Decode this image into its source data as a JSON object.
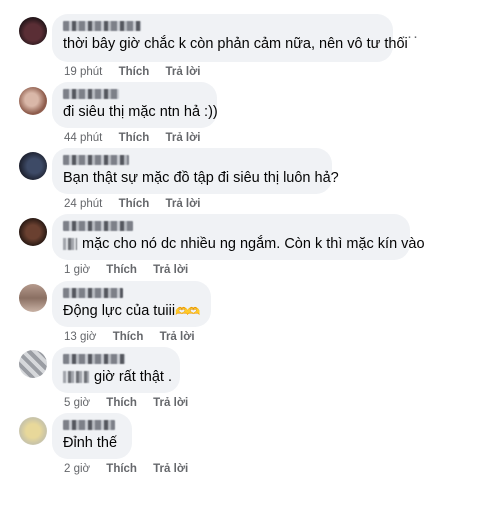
{
  "more_icon": "ellipsis-icon",
  "comments": [
    {
      "text": "thời bây giờ chắc k còn phản cảm nữa, nên vô tư thôi",
      "time": "19 phút",
      "like": "Thích",
      "reply": "Trả lời"
    },
    {
      "text": "đi siêu thị mặc ntn hả :))",
      "time": "44 phút",
      "like": "Thích",
      "reply": "Trả lời"
    },
    {
      "text": "Bạn thật sự mặc đồ tập đi siêu thị luôn hả?",
      "time": "24 phút",
      "like": "Thích",
      "reply": "Trả lời"
    },
    {
      "text": "mặc cho nó dc nhiều ng ngắm. Còn k thì mặc kín vào",
      "time": "1 giờ",
      "like": "Thích",
      "reply": "Trả lời"
    },
    {
      "text": "Động lực của tuiii",
      "emoji": "🫶🫶",
      "time": "13 giờ",
      "like": "Thích",
      "reply": "Trả lời"
    },
    {
      "text": "giờ rất thật .",
      "time": "5 giờ",
      "like": "Thích",
      "reply": "Trả lời"
    },
    {
      "text": "Đỉnh thế",
      "time": "2 giờ",
      "like": "Thích",
      "reply": "Trả lời"
    }
  ],
  "colors": {
    "bubble_bg": "#f0f2f5",
    "meta_text": "#65676b",
    "body_text": "#050505"
  }
}
